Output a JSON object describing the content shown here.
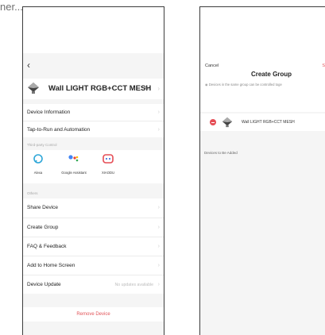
{
  "caption": "ner...",
  "screen1": {
    "back_icon": "chevron-left-icon",
    "device_name": "Wall LIGHT RGB+CCT MESH",
    "device_icon": "bulb-icon",
    "edit_icon": "pencil-icon",
    "group1": [
      "Device Information",
      "Tap-to-Run and Automation"
    ],
    "third_party_label": "Third-party Control",
    "third_party": [
      {
        "name": "Alexa",
        "icon": "alexa-icon",
        "color": "#2fa7d8"
      },
      {
        "name": "Google Assistant",
        "icon": "google-assistant-icon",
        "color": "#4285f4"
      },
      {
        "name": "XIAODU",
        "icon": "xiaodu-icon",
        "color": "#e54d55"
      }
    ],
    "others_label": "Others",
    "others": [
      "Share Device",
      "Create Group",
      "FAQ & Feedback",
      "Add to Home Screen",
      "Device Update"
    ],
    "device_update_value": "No updates available",
    "remove": "Remove Device",
    "accent_color": "#e2555a"
  },
  "screen2": {
    "cancel": "Cancel",
    "save": "S",
    "title": "Create Group",
    "note": "Devices in the same group can be controlled toge",
    "device_name": "Wall LIGHT RGB+CCT MESH",
    "devices_to_add": "Devices to Be Added",
    "remove_icon": "minus-circle-icon",
    "device_icon": "bulb-icon"
  }
}
